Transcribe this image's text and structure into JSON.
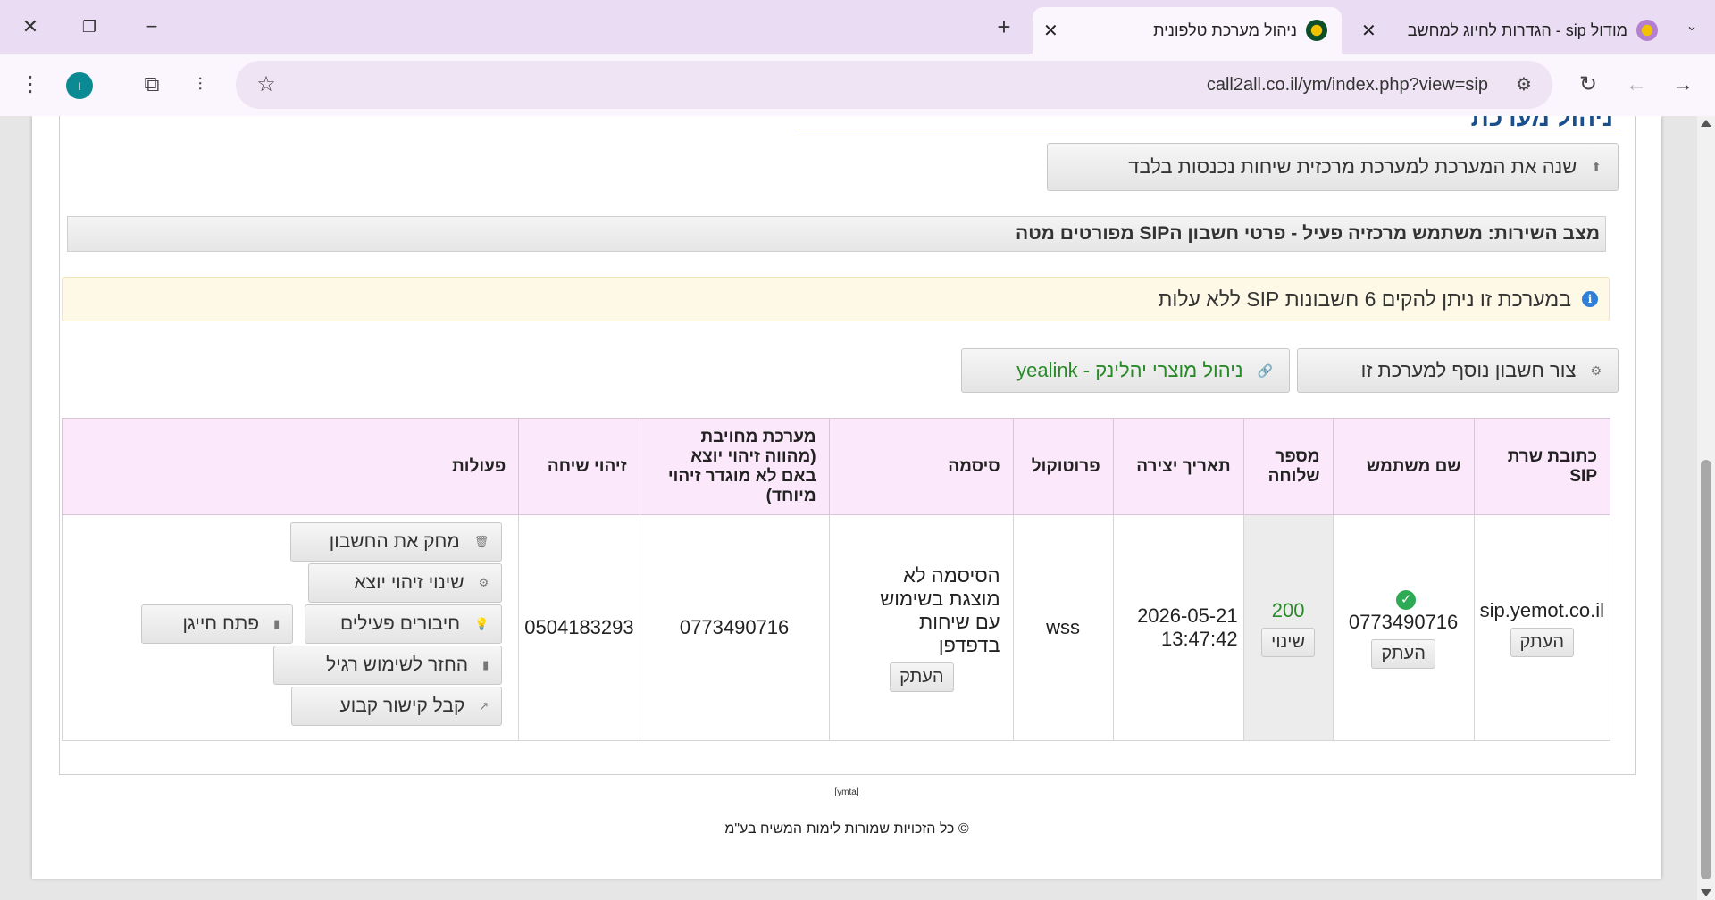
{
  "browser": {
    "tabs": [
      {
        "title": "מודול sip - הגדרות לחיוג למחשב",
        "active": false
      },
      {
        "title": "ניהול מערכת טלפונית",
        "active": true
      }
    ],
    "url": "call2all.co.il/ym/index.php?view=sip",
    "profile_initial": "ו"
  },
  "page": {
    "heading_partial": "ניהול מערכת",
    "switch_button": "שנה את המערכת למערכת מרכזית שיחות נכנסות בלבד",
    "status_text": "מצב השירות: משתמש מרכזיה פעיל - פרטי חשבון הSIP מפורטים מטה",
    "notice_text": "במערכת זו ניתן להקים 6 חשבונות SIP ללא עלות",
    "create_account_button": "צור חשבון נוסף למערכת זו",
    "yealink_button": "ניהול מוצרי יהלינק - yealink"
  },
  "table": {
    "headers": {
      "server": "כתובת שרת SIP",
      "username": "שם משתמש",
      "extension": "מספר שלוחה",
      "created": "תאריך יצירה",
      "protocol": "פרוטוקול",
      "password": "סיסמה",
      "billed_system": "מערכת מחויבת (מהווה זיהוי יוצא באם לא מוגדר זיהוי מיוחד)",
      "caller_id": "זיהוי שיחה",
      "actions": "פעולות"
    },
    "row": {
      "server": "sip.yemot.co.il",
      "username": "0773490716",
      "extension": "200",
      "created": "2026-05-21 13:47:42",
      "protocol": "wss",
      "password_note": "הסיסמה לא מוצגת בשימוש עם שיחות בדפדפן",
      "billed_system": "0773490716",
      "caller_id": "0504183293",
      "copy_label": "העתק",
      "change_label": "שינוי"
    },
    "actions": {
      "delete": "מחק את החשבון",
      "change_caller_id": "שינוי זיהוי יוצא",
      "active_connections": "חיבורים פעילים",
      "open_dialer": "פתח חייגן",
      "restore_regular": "החזר לשימוש רגיל",
      "permanent_link": "קבל קישור קבוע"
    }
  },
  "footer": {
    "small_tag": "[ymta]",
    "copyright": "© כל הזכויות שמורות לימות המשיח בע\"מ"
  }
}
